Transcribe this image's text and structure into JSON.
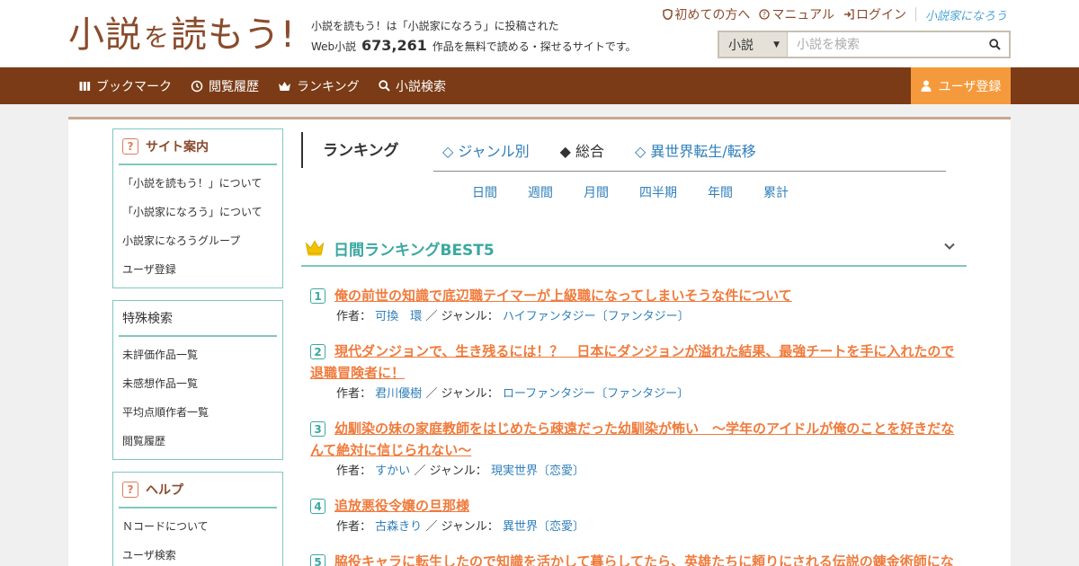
{
  "logo": {
    "part1": "小説",
    "part2": "を",
    "part3": "読もう!"
  },
  "tagline": {
    "line1": "小説を読もう！は「小説家になろう」に投稿された",
    "prefix": "Web小説",
    "count": "673,261",
    "suffix": "作品を無料で読める・探せるサイトです。"
  },
  "toplinks": {
    "first": "初めての方へ",
    "manual": "マニュアル",
    "login": "ログイン",
    "narou": "小説家になろう"
  },
  "search": {
    "type": "小説",
    "placeholder": "小説を検索"
  },
  "nav": {
    "bookmark": "ブックマーク",
    "history": "閲覧履歴",
    "ranking": "ランキング",
    "search": "小説検索",
    "register": "ユーザ登録"
  },
  "sidebar": {
    "site": {
      "title": "サイト案内",
      "items": [
        "「小説を読もう！」について",
        "「小説家になろう」について",
        "小説家になろうグループ",
        "ユーザ登録"
      ]
    },
    "special": {
      "title": "特殊検索",
      "items": [
        "未評価作品一覧",
        "未感想作品一覧",
        "平均点順作者一覧",
        "閲覧履歴"
      ]
    },
    "help": {
      "title": "ヘルプ",
      "items": [
        "Ｎコードについて",
        "ユーザ検索"
      ]
    }
  },
  "ranking": {
    "title": "ランキング",
    "tabs": [
      "◇ ジャンル別",
      "◆ 総合",
      "◇ 異世界転生/転移"
    ],
    "periods": [
      "日間",
      "週間",
      "月間",
      "四半期",
      "年間",
      "累計"
    ],
    "best_title": "日間ランキングBEST5",
    "author_label": "作者：",
    "genre_label": "／ ジャンル：",
    "items": [
      {
        "rank": "1",
        "title": "俺の前世の知識で底辺職テイマーが上級職になってしまいそうな件について",
        "author": "可換　環",
        "genre": "ハイファンタジー〔ファンタジー〕"
      },
      {
        "rank": "2",
        "title": "現代ダンジョンで、生き残るには！？　日本にダンジョンが溢れた結果、最強チートを手に入れたので退職冒険者に！",
        "author": "君川優樹",
        "genre": "ローファンタジー〔ファンタジー〕"
      },
      {
        "rank": "3",
        "title": "幼馴染の妹の家庭教師をはじめたら疎遠だった幼馴染が怖い　〜学年のアイドルが俺のことを好きだなんて絶対に信じられない〜",
        "author": "すかい",
        "genre": "現実世界〔恋愛〕"
      },
      {
        "rank": "4",
        "title": "追放悪役令嬢の旦那様",
        "author": "古森きり",
        "genre": "異世界〔恋愛〕"
      },
      {
        "rank": "5",
        "title": "脇役キャラに転生したので知識を活かして暮らしてたら、英雄たちに頼りにされる伝説の錬金術師にな",
        "author": "",
        "genre": ""
      }
    ]
  },
  "colors": {
    "brand": "#7a3b16",
    "accent": "#f59a3c",
    "teal": "#3aa8a0",
    "link": "#2f7fba",
    "title_link": "#f07b3c"
  }
}
